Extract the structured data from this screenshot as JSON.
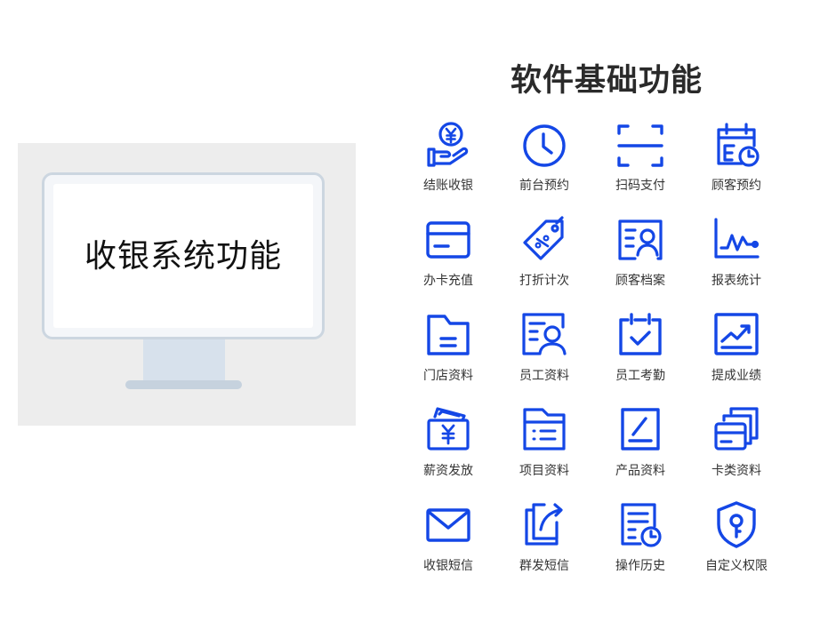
{
  "hero": {
    "title": "收银系统功能"
  },
  "section": {
    "title": "软件基础功能",
    "accent_color": "#1447e6"
  },
  "features": [
    {
      "label": "结账收银",
      "icon": "yen-coin-hand-icon"
    },
    {
      "label": "前台预约",
      "icon": "clock-icon"
    },
    {
      "label": "扫码支付",
      "icon": "scan-frame-icon"
    },
    {
      "label": "顾客预约",
      "icon": "calendar-clock-icon"
    },
    {
      "label": "办卡充值",
      "icon": "card-icon"
    },
    {
      "label": "打折计次",
      "icon": "discount-tag-icon"
    },
    {
      "label": "顾客档案",
      "icon": "profile-card-icon"
    },
    {
      "label": "报表统计",
      "icon": "line-chart-icon"
    },
    {
      "label": "门店资料",
      "icon": "folder-icon"
    },
    {
      "label": "员工资料",
      "icon": "employee-card-icon"
    },
    {
      "label": "员工考勤",
      "icon": "calendar-check-icon"
    },
    {
      "label": "提成业绩",
      "icon": "trend-chart-icon"
    },
    {
      "label": "薪资发放",
      "icon": "yen-envelope-icon"
    },
    {
      "label": "项目资料",
      "icon": "list-folder-icon"
    },
    {
      "label": "产品资料",
      "icon": "document-edit-icon"
    },
    {
      "label": "卡类资料",
      "icon": "stacked-cards-icon"
    },
    {
      "label": "收银短信",
      "icon": "mail-icon"
    },
    {
      "label": "群发短信",
      "icon": "share-copy-icon"
    },
    {
      "label": "操作历史",
      "icon": "document-clock-icon"
    },
    {
      "label": "自定义权限",
      "icon": "shield-key-icon"
    }
  ]
}
